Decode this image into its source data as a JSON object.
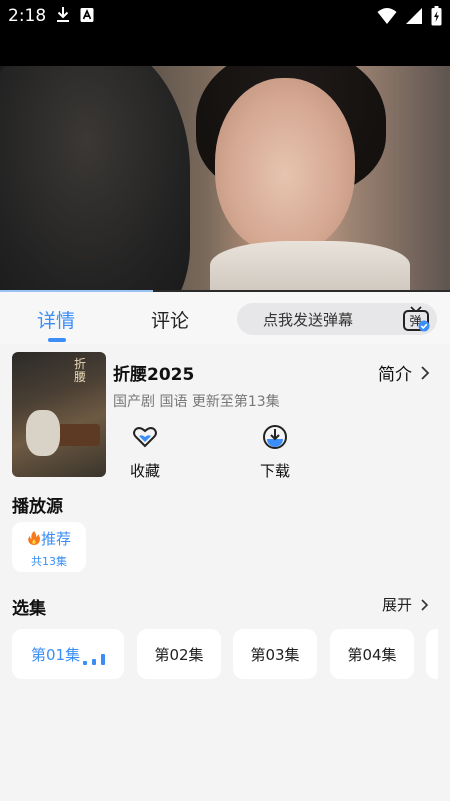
{
  "status_bar": {
    "time": "2:18",
    "icons": [
      "download-icon",
      "a-box-icon",
      "wifi-icon",
      "signal-icon",
      "battery-charging-icon"
    ]
  },
  "player": {
    "progress_fraction": 0.34
  },
  "tabs": [
    {
      "label": "详情",
      "active": true
    },
    {
      "label": "评论",
      "active": false
    }
  ],
  "danmaku": {
    "placeholder": "点我发送弹幕",
    "icon_text": "弹"
  },
  "show": {
    "poster_text": "折腰",
    "title": "折腰2025",
    "intro_label": "简介",
    "meta": "国产剧 国语 更新至第13集",
    "actions": [
      {
        "label": "收藏",
        "icon": "heart-icon"
      },
      {
        "label": "下载",
        "icon": "download-circle-icon"
      }
    ]
  },
  "source": {
    "section_title": "播放源",
    "name": "推荐",
    "count": "共13集",
    "icon": "fire-icon"
  },
  "episodes": {
    "section_title": "选集",
    "expand_label": "展开",
    "items": [
      {
        "label": "第01集",
        "active": true
      },
      {
        "label": "第02集",
        "active": false
      },
      {
        "label": "第03集",
        "active": false
      },
      {
        "label": "第04集",
        "active": false
      }
    ]
  },
  "colors": {
    "accent": "#3a8ef6",
    "background": "#f4f4f4"
  }
}
